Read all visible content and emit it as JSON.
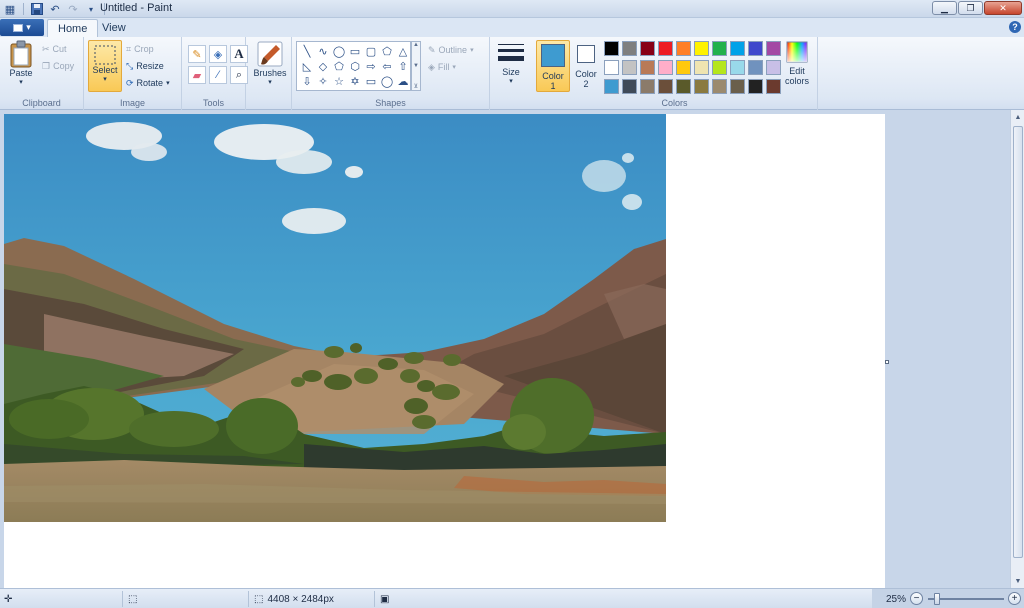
{
  "window": {
    "title": "Untitled - Paint"
  },
  "tabs": [
    {
      "label": "Home"
    },
    {
      "label": "View"
    }
  ],
  "ribbon": {
    "clipboard": {
      "label": "Clipboard",
      "paste": "Paste",
      "cut": "Cut",
      "copy": "Copy"
    },
    "image": {
      "label": "Image",
      "select": "Select",
      "crop": "Crop",
      "resize": "Resize",
      "rotate": "Rotate"
    },
    "tools": {
      "label": "Tools"
    },
    "brushes": {
      "label": "Brushes"
    },
    "shapes": {
      "label": "Shapes",
      "outline": "Outline",
      "fill": "Fill"
    },
    "size": {
      "label": "Size"
    },
    "colors": {
      "label": "Colors",
      "color1_label": "Color",
      "color1_num": "1",
      "color2_label": "Color",
      "color2_num": "2",
      "color1_value": "#3e9bd0",
      "color2_value": "#ffffff",
      "edit": "Edit colors",
      "palette": [
        "#000000",
        "#7f7f7f",
        "#880015",
        "#ed1c24",
        "#ff7f27",
        "#fff200",
        "#22b14c",
        "#00a2e8",
        "#3f48cc",
        "#a349a4",
        "#ffffff",
        "#c3c3c3",
        "#b97a57",
        "#ffaec9",
        "#ffc90e",
        "#efe4b0",
        "#b5e61d",
        "#99d9ea",
        "#7092be",
        "#c8bfe7",
        "#3e9bd0",
        "#3f4a58",
        "#8b7b6a",
        "#6b4f3a",
        "#5a5a2a",
        "#8a7a40",
        "#9b8a6e",
        "#6a5f4c",
        "#222222",
        "#6b3a2e"
      ]
    }
  },
  "status": {
    "dimensions": "4408 × 2484px",
    "zoom": "25%"
  }
}
